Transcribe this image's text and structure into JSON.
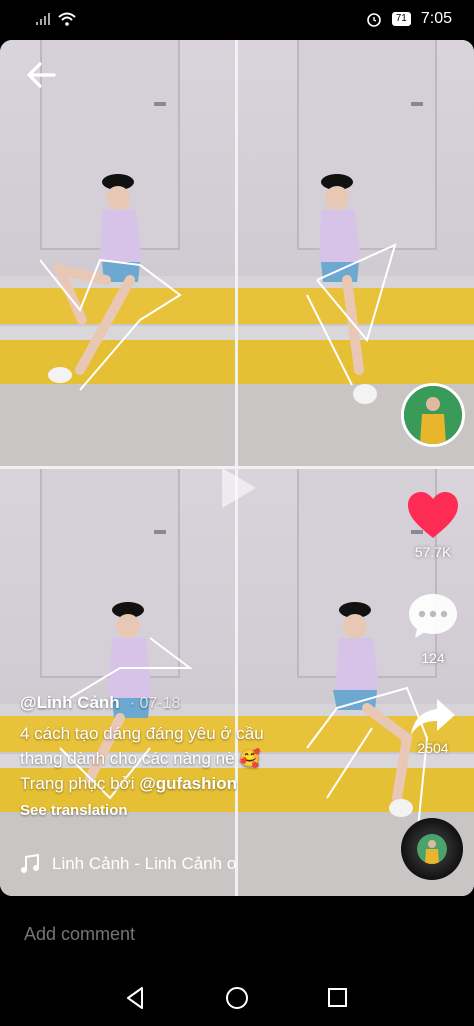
{
  "status": {
    "battery": "71",
    "time": "7:05"
  },
  "video": {
    "author": "@Linh Cảnh",
    "date": "· 07-18",
    "description_line1": "4 cách tạo dáng đáng yêu ở cầu",
    "description_line2": "thang dành cho các nàng nè 🥰",
    "description_line3_prefix": "Trang phục bởi ",
    "description_tag": "@gufashion",
    "see_translation": "See translation",
    "music": "Linh Cảnh - Linh Cảnh   o"
  },
  "actions": {
    "likes": "57.7K",
    "comments": "124",
    "shares": "2504"
  },
  "comment_bar": {
    "placeholder": "Add comment"
  },
  "colors": {
    "like": "#fe2c55",
    "wall_yellow": "#e8c23a"
  },
  "icons": [
    "back-arrow-icon",
    "play-icon",
    "heart-icon",
    "comment-icon",
    "share-icon",
    "music-note-icon",
    "wifi-icon",
    "signal-icon",
    "alarm-icon"
  ]
}
